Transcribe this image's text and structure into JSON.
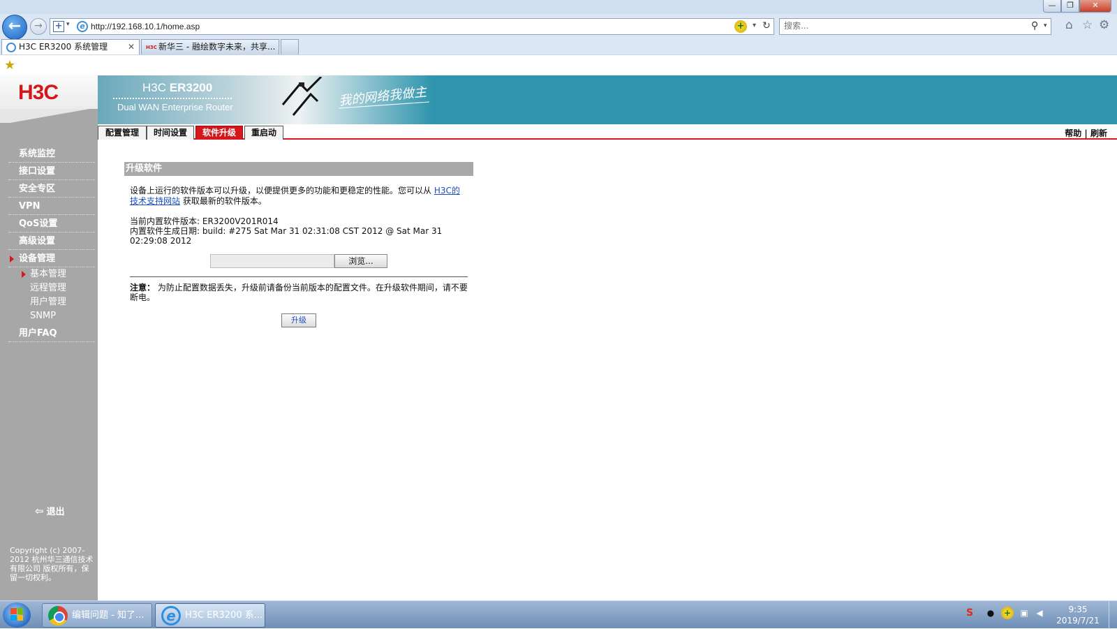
{
  "browser": {
    "address": "http://192.168.10.1/home.asp",
    "search_placeholder": "搜索...",
    "tabs": [
      {
        "label": "H3C ER3200 系统管理"
      },
      {
        "label": "新华三 - 融绘数字未来，共享..."
      }
    ],
    "window_buttons": {
      "min": "—",
      "max": "❐",
      "close": "✕"
    }
  },
  "banner": {
    "logo": "H3C",
    "model_prefix": "H3C",
    "model": "ER3200",
    "subtitle": "Dual WAN Enterprise Router",
    "slogan": "我的网络我做主"
  },
  "subnav": {
    "tabs": [
      "配置管理",
      "时间设置",
      "软件升级",
      "重启动"
    ],
    "active": "软件升级",
    "help": "帮助",
    "separator": "|",
    "refresh": "刷新"
  },
  "sidebar": {
    "items": [
      {
        "label": "系统监控"
      },
      {
        "label": "接口设置"
      },
      {
        "label": "安全专区"
      },
      {
        "label": "VPN"
      },
      {
        "label": "QoS设置"
      },
      {
        "label": "高级设置"
      },
      {
        "label": "设备管理"
      }
    ],
    "subitems": [
      {
        "label": "基本管理"
      },
      {
        "label": "远程管理"
      },
      {
        "label": "用户管理"
      },
      {
        "label": "SNMP"
      }
    ],
    "faq": "用户FAQ",
    "logout": "退出",
    "copyright": "Copyright (c) 2007-2012  杭州华三通信技术有限公司 版权所有，保留一切权利。"
  },
  "panel": {
    "title": "升级软件",
    "desc_prefix": "设备上运行的软件版本可以升级，以便提供更多的功能和更稳定的性能。您可以从",
    "desc_link": "H3C的技术支持网站",
    "desc_suffix": "获取最新的软件版本。",
    "current_version_label": "当前内置软件版本:",
    "current_version": "ER3200V201R014",
    "build_date_label": "内置软件生成日期:",
    "build_date": "build: #275 Sat Mar 31 02:31:08 CST 2012 @ Sat Mar 31 02:29:08 2012",
    "browse_label": "浏览...",
    "note_label": "注意：",
    "note_text": "为防止配置数据丢失，升级前请备份当前版本的配置文件。在升级软件期间，请不要断电。",
    "upgrade_label": "升级"
  },
  "taskbar": {
    "items": [
      {
        "label": "编辑问题 - 知了..."
      },
      {
        "label": "H3C ER3200 系..."
      }
    ],
    "time": "9:35",
    "date": "2019/7/21"
  }
}
